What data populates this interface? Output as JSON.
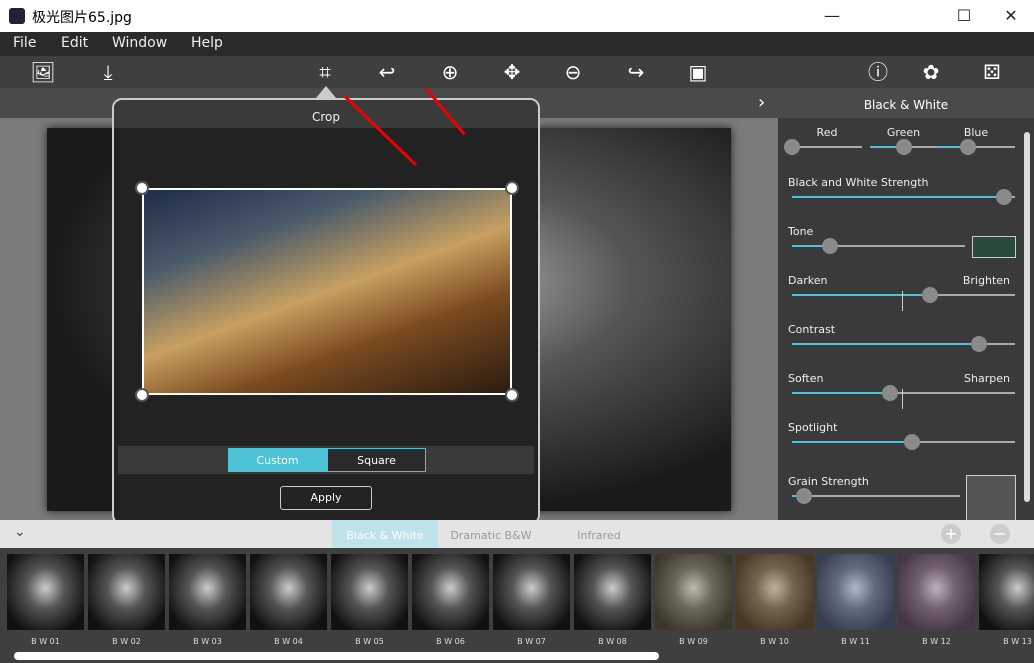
{
  "window": {
    "title": "极光图片65.jpg",
    "minimize": "—",
    "maximize": "☐",
    "close": "✕"
  },
  "menu": [
    "File",
    "Edit",
    "Window",
    "Help"
  ],
  "toolbar": {
    "icons": [
      "open-image-icon",
      "save-icon",
      "crop-icon",
      "rotate-left-icon",
      "zoom-in-icon",
      "move-icon",
      "zoom-out-icon",
      "rotate-right-icon",
      "fit-image-icon",
      "info-icon",
      "settings-icon",
      "random-dice-icon"
    ]
  },
  "panel": {
    "title": "Black & White",
    "expand": "›",
    "channels": [
      {
        "label": "Red",
        "value": 0.0
      },
      {
        "label": "Green",
        "value": 0.5
      },
      {
        "label": "Blue",
        "value": 0.4
      }
    ],
    "sliders": [
      {
        "label": "Black and White Strength",
        "value": 0.95
      },
      {
        "label": "Tone",
        "value": 0.22,
        "swatch": "#2a4a3c"
      },
      {
        "label": "Darken",
        "label_right": "Brighten",
        "value": 0.62
      },
      {
        "label": "Contrast",
        "value": 0.84
      },
      {
        "label": "Soften",
        "label_right": "Sharpen",
        "value": 0.44
      },
      {
        "label": "Spotlight",
        "value": 0.54
      },
      {
        "label": "Grain Strength",
        "value": 0.07
      }
    ]
  },
  "crop": {
    "title": "Crop",
    "modes": [
      "Custom",
      "Square"
    ],
    "active_mode": "Custom",
    "apply": "Apply"
  },
  "presets": {
    "collapse": "⌄",
    "tabs": [
      "Black & White",
      "Dramatic B&W",
      "Infrared"
    ],
    "active": "Black & White",
    "add": "+",
    "remove": "−",
    "thumbs": [
      "B W 01",
      "B W 02",
      "B W 03",
      "B W 04",
      "B W 05",
      "B W 06",
      "B W 07",
      "B W 08",
      "B W 09",
      "B W 10",
      "B W 11",
      "B W 12",
      "B W 13"
    ]
  },
  "colors": {
    "accent": "#4cc3d6",
    "annotation_arrow": "#e00000"
  }
}
